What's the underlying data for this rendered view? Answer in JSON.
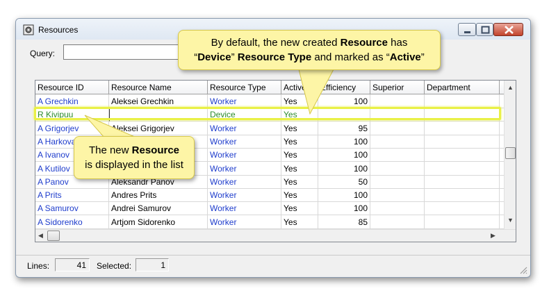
{
  "window": {
    "title": "Resources"
  },
  "query": {
    "label": "Query:",
    "value": ""
  },
  "grid": {
    "columns": [
      "Resource ID",
      "Resource Name",
      "Resource Type",
      "Active",
      "Efficiency",
      "Superior",
      "Department"
    ],
    "rows": [
      {
        "id": "A Grechkin",
        "name": "Aleksei Grechkin",
        "type": "Worker",
        "active": "Yes",
        "efficiency": "100",
        "superior": "",
        "department": ""
      },
      {
        "id": "R Kivipuu",
        "name": "",
        "type": "Device",
        "active": "Yes",
        "efficiency": "",
        "superior": "",
        "department": ""
      },
      {
        "id": "A Grigorjev",
        "name": "Aleksei Grigorjev",
        "type": "Worker",
        "active": "Yes",
        "efficiency": "95",
        "superior": "",
        "department": ""
      },
      {
        "id": "A Harkova",
        "name": "",
        "type": "Worker",
        "active": "Yes",
        "efficiency": "100",
        "superior": "",
        "department": ""
      },
      {
        "id": "A Ivanov",
        "name": "",
        "type": "Worker",
        "active": "Yes",
        "efficiency": "100",
        "superior": "",
        "department": ""
      },
      {
        "id": "A Kutilov",
        "name": "",
        "type": "Worker",
        "active": "Yes",
        "efficiency": "100",
        "superior": "",
        "department": ""
      },
      {
        "id": "A Panov",
        "name": "Aleksandr Panov",
        "type": "Worker",
        "active": "Yes",
        "efficiency": "50",
        "superior": "",
        "department": ""
      },
      {
        "id": "A Prits",
        "name": "Andres Prits",
        "type": "Worker",
        "active": "Yes",
        "efficiency": "100",
        "superior": "",
        "department": ""
      },
      {
        "id": "A Samurov",
        "name": "Andrei Samurov",
        "type": "Worker",
        "active": "Yes",
        "efficiency": "100",
        "superior": "",
        "department": ""
      },
      {
        "id": "A Sidorenko",
        "name": "Artjom Sidorenko",
        "type": "Worker",
        "active": "Yes",
        "efficiency": "85",
        "superior": "",
        "department": ""
      }
    ]
  },
  "status": {
    "lines_label": "Lines:",
    "lines_value": "41",
    "selected_label": "Selected:",
    "selected_value": "1"
  },
  "callouts": {
    "top": {
      "line1_a": "By default, the new created ",
      "line1_b": "Resource",
      "line1_c": " has",
      "line2_a": "“",
      "line2_b": "Device",
      "line2_c": "” ",
      "line2_d": "Resource Type",
      "line2_e": " and marked as “",
      "line2_f": "Active",
      "line2_g": "”"
    },
    "left": {
      "line1_a": "The new ",
      "line1_b": "Resource",
      "line2": "is displayed in the list"
    }
  },
  "colors": {
    "id_link": "#1e3ccc",
    "new_row": "#2a8a2a",
    "highlight": "#e9f046",
    "callout_bg": "#fdf5a6"
  }
}
